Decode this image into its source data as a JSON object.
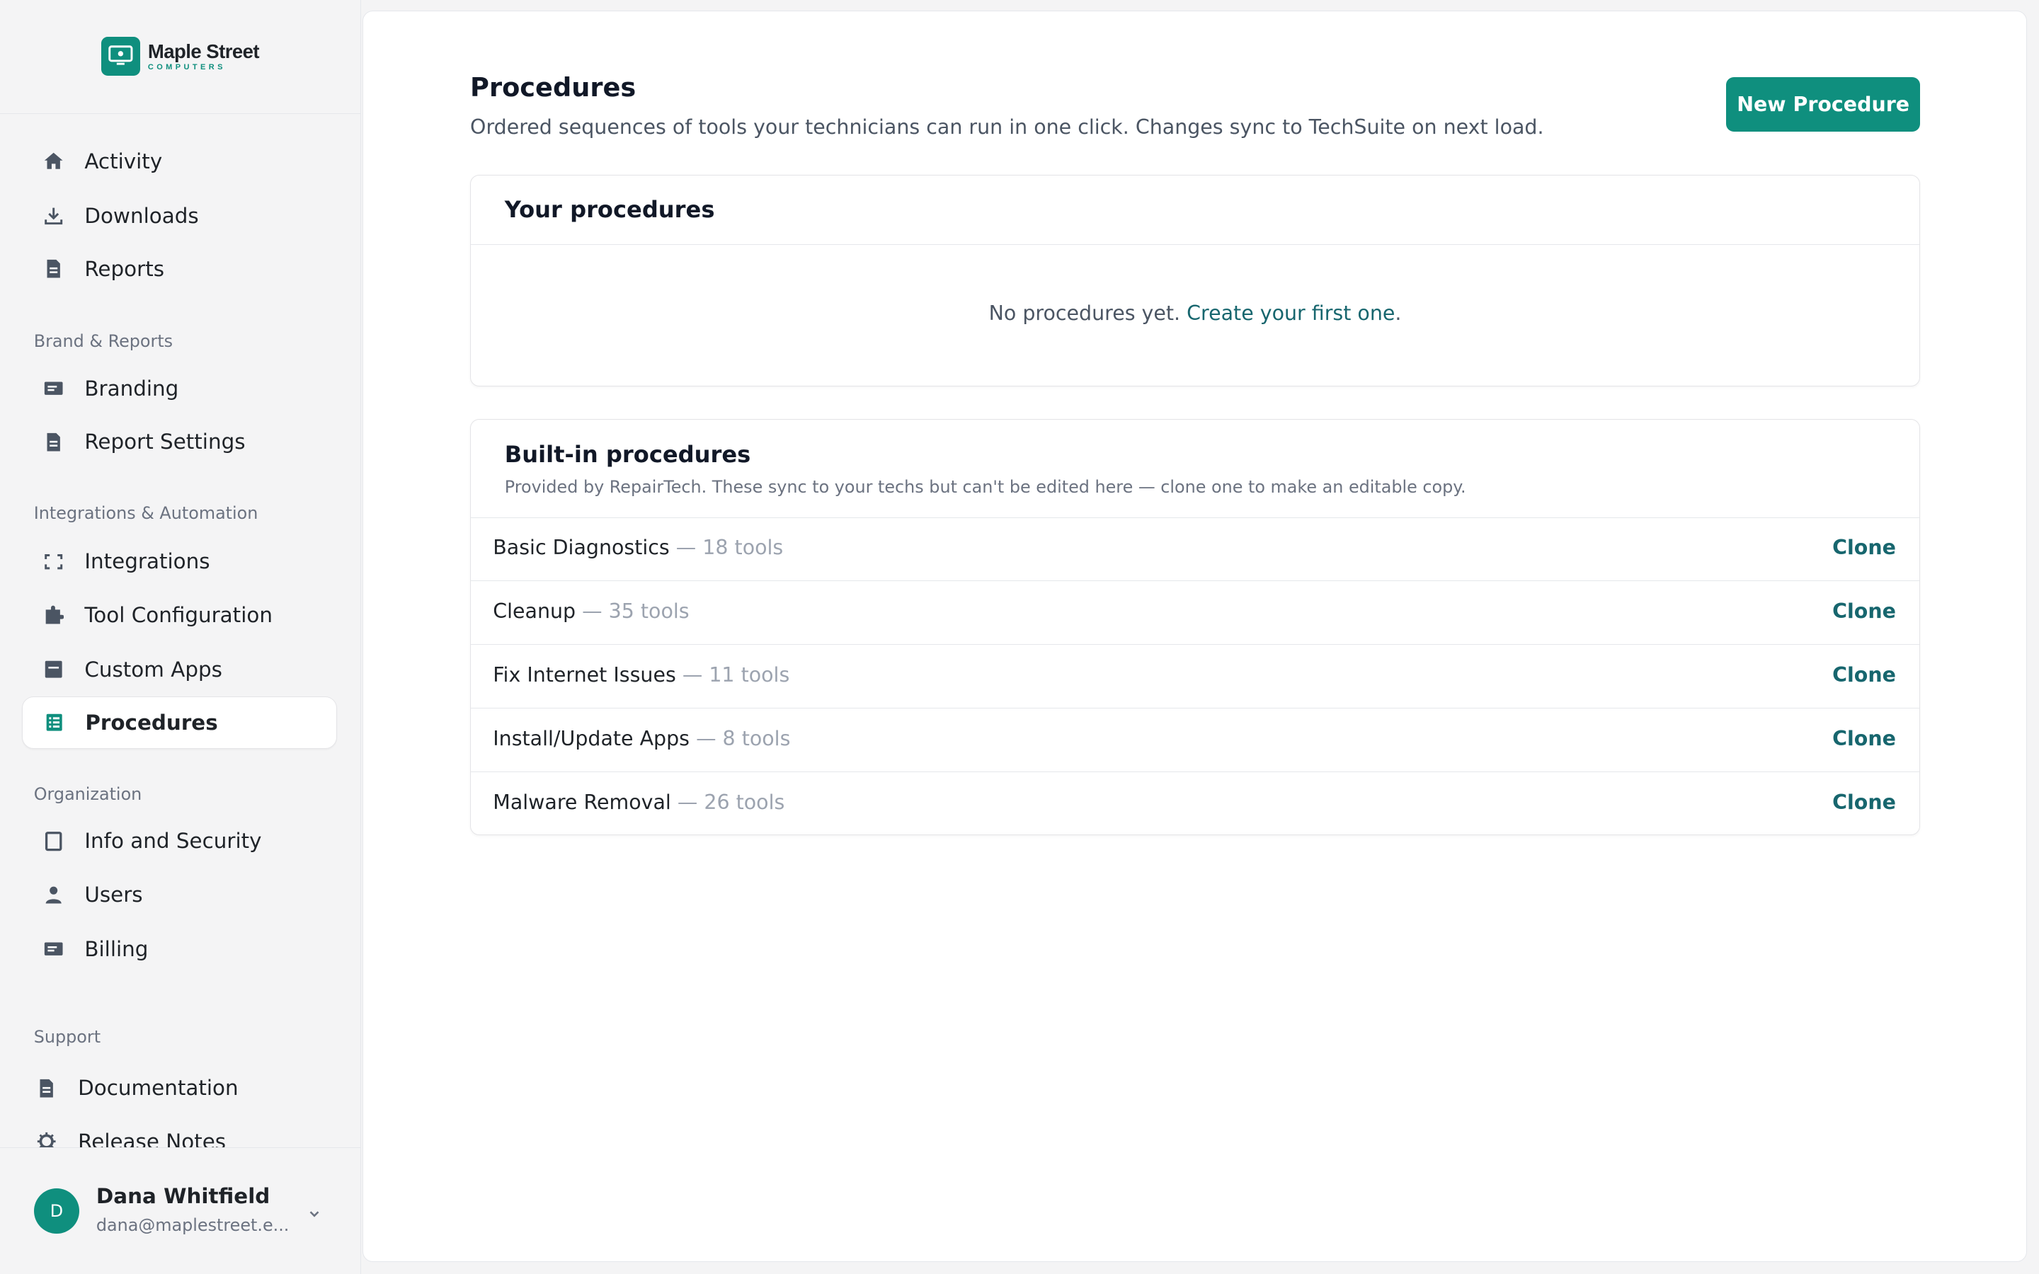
{
  "brand": {
    "name": "Maple Street",
    "sub": "COMPUTERS"
  },
  "sidebar": {
    "items_top": [
      {
        "label": "Activity",
        "icon": "home-icon"
      },
      {
        "label": "Downloads",
        "icon": "download-icon"
      },
      {
        "label": "Reports",
        "icon": "document-icon"
      }
    ],
    "sections": [
      {
        "title": "Brand & Reports",
        "items": [
          {
            "label": "Branding",
            "icon": "card-icon"
          },
          {
            "label": "Report Settings",
            "icon": "document-icon"
          }
        ]
      },
      {
        "title": "Integrations & Automation",
        "items": [
          {
            "label": "Integrations",
            "icon": "link-icon"
          },
          {
            "label": "Tool Configuration",
            "icon": "puzzle-icon"
          },
          {
            "label": "Custom Apps",
            "icon": "app-icon"
          },
          {
            "label": "Procedures",
            "icon": "list-icon"
          }
        ]
      },
      {
        "title": "Organization",
        "items": [
          {
            "label": "Info and Security",
            "icon": "square-icon"
          },
          {
            "label": "Users",
            "icon": "user-icon"
          },
          {
            "label": "Billing",
            "icon": "card-icon"
          }
        ]
      },
      {
        "title": "Support",
        "items": [
          {
            "label": "Documentation",
            "icon": "document-icon"
          },
          {
            "label": "Release Notes",
            "icon": "gear-icon"
          }
        ]
      }
    ],
    "active": "Procedures",
    "user": {
      "initial": "D",
      "name": "Dana Whitfield",
      "email": "dana@maplestreet.e..."
    }
  },
  "main": {
    "title": "Procedures",
    "subtitle": "Ordered sequences of tools your technicians can run in one click. Changes sync to TechSuite on next load.",
    "new_button": "New Procedure",
    "your_procedures": {
      "title": "Your procedures",
      "empty_text": "No procedures yet.",
      "empty_link": "Create your first one",
      "empty_end": "."
    },
    "builtin": {
      "title": "Built-in procedures",
      "subtitle": "Provided by RepairTech. These sync to your techs but can't be edited here — clone one to make an editable copy.",
      "rows": [
        {
          "name": "Basic Diagnostics",
          "count": "— 18 tools",
          "action": "Clone"
        },
        {
          "name": "Cleanup",
          "count": "— 35 tools",
          "action": "Clone"
        },
        {
          "name": "Fix Internet Issues",
          "count": "— 11 tools",
          "action": "Clone"
        },
        {
          "name": "Install/Update Apps",
          "count": "— 8 tools",
          "action": "Clone"
        },
        {
          "name": "Malware Removal",
          "count": "— 26 tools",
          "action": "Clone"
        }
      ]
    }
  },
  "colors": {
    "accent": "#0f8f7e",
    "link": "#17666e",
    "sidebar_bg": "#f4f4f5"
  }
}
